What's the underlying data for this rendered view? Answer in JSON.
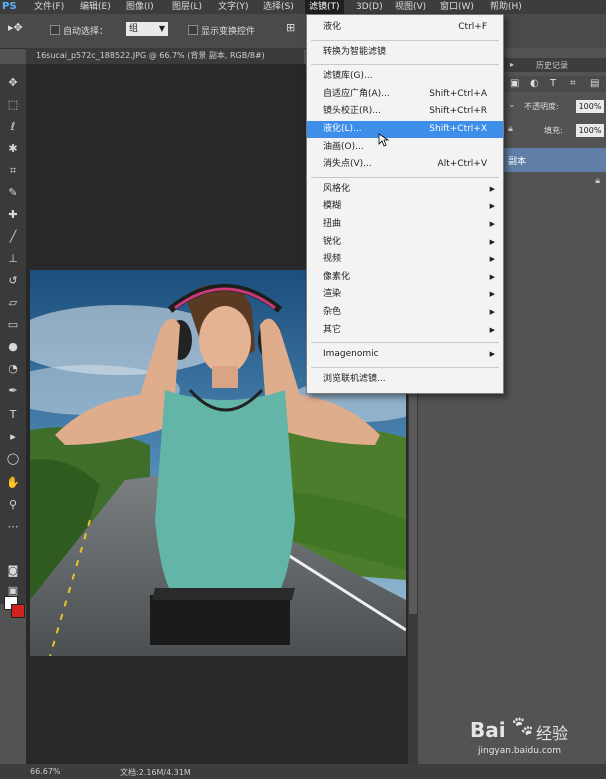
{
  "menubar": {
    "app_logo": "PS",
    "items": [
      "文件(F)",
      "编辑(E)",
      "图像(I)",
      "图层(L)",
      "文字(Y)",
      "选择(S)",
      "滤镜(T)",
      "3D(D)",
      "视图(V)",
      "窗口(W)",
      "帮助(H)"
    ]
  },
  "options_bar": {
    "auto_select_label": "自动选择：",
    "auto_select_value": "组",
    "show_transform_label": "显示变换控件"
  },
  "document": {
    "tab_title": "16sucai_p572c_188522.JPG @ 66.7% (背景 副本, RGB/8#)"
  },
  "filter_menu": {
    "items": [
      {
        "label": "液化",
        "shortcut": "Ctrl+F",
        "submenu": false,
        "highlight": false
      },
      {
        "label": "转换为智能滤镜",
        "shortcut": "",
        "submenu": false,
        "highlight": false
      },
      {
        "label": "滤镜库(G)...",
        "shortcut": "",
        "submenu": false,
        "highlight": false
      },
      {
        "label": "自适应广角(A)...",
        "shortcut": "Shift+Ctrl+A",
        "submenu": false,
        "highlight": false
      },
      {
        "label": "镜头校正(R)...",
        "shortcut": "Shift+Ctrl+R",
        "submenu": false,
        "highlight": false
      },
      {
        "label": "液化(L)...",
        "shortcut": "Shift+Ctrl+X",
        "submenu": false,
        "highlight": true
      },
      {
        "label": "油画(O)...",
        "shortcut": "",
        "submenu": false,
        "highlight": false
      },
      {
        "label": "消失点(V)...",
        "shortcut": "Alt+Ctrl+V",
        "submenu": false,
        "highlight": false
      },
      {
        "label": "风格化",
        "shortcut": "",
        "submenu": true,
        "highlight": false
      },
      {
        "label": "模糊",
        "shortcut": "",
        "submenu": true,
        "highlight": false
      },
      {
        "label": "扭曲",
        "shortcut": "",
        "submenu": true,
        "highlight": false
      },
      {
        "label": "锐化",
        "shortcut": "",
        "submenu": true,
        "highlight": false
      },
      {
        "label": "视频",
        "shortcut": "",
        "submenu": true,
        "highlight": false
      },
      {
        "label": "像素化",
        "shortcut": "",
        "submenu": true,
        "highlight": false
      },
      {
        "label": "渲染",
        "shortcut": "",
        "submenu": true,
        "highlight": false
      },
      {
        "label": "杂色",
        "shortcut": "",
        "submenu": true,
        "highlight": false
      },
      {
        "label": "其它",
        "shortcut": "",
        "submenu": true,
        "highlight": false
      },
      {
        "label": "Imagenomic",
        "shortcut": "",
        "submenu": true,
        "highlight": false
      },
      {
        "label": "浏览联机滤镜...",
        "shortcut": "",
        "submenu": false,
        "highlight": false
      }
    ]
  },
  "right_panel": {
    "tab_history": "历史记录",
    "opacity_label": "不透明度:",
    "opacity_value": "100%",
    "fill_label": "填充:",
    "fill_value": "100%",
    "layer_name": "副本"
  },
  "status": {
    "zoom": "66.67%",
    "doc_size": "文档:2.16M/4.31M"
  },
  "watermark": {
    "brand": "Bai",
    "brand_cn": "经验",
    "url": "jingyan.baidu.com"
  },
  "colors": {
    "accent_highlight": "#3d8ee8",
    "foreground_swatch": "#ffffff",
    "background_swatch": "#d2221d"
  }
}
